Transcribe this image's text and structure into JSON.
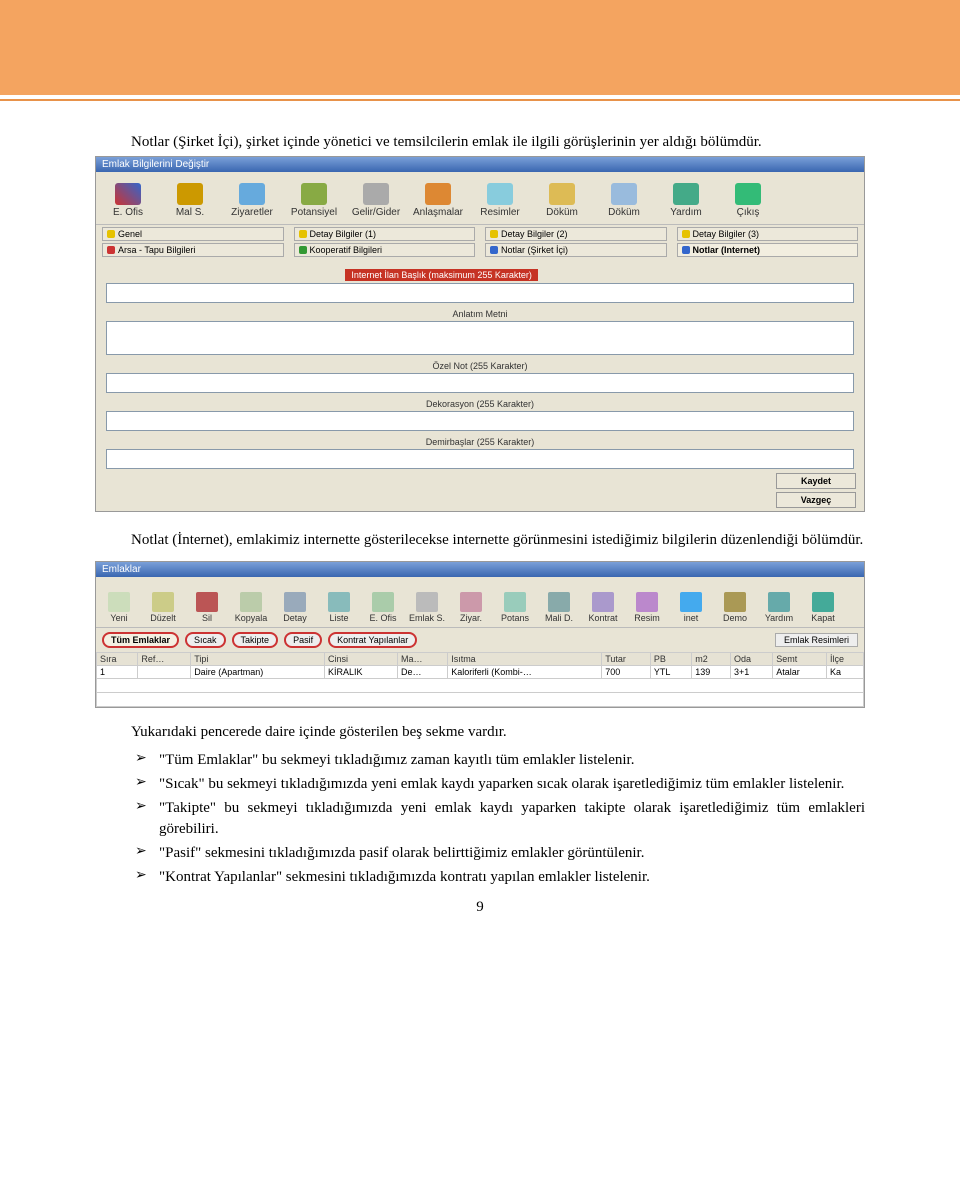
{
  "paragraphs": {
    "p1": "Notlar (Şirket İçi), şirket içinde yönetici ve temsilcilerin emlak ile ilgili görüşlerinin yer aldığı bölümdür.",
    "p2": "Notlat (İnternet), emlakimiz internette gösterilecekse internette görünmesini istediğimiz bilgilerin düzenlendiği bölümdür.",
    "p3": "Yukarıdaki pencerede daire içinde gösterilen beş sekme vardır."
  },
  "bullets": [
    "\"Tüm Emlaklar\" bu sekmeyi tıkladığımız zaman kayıtlı tüm emlakler listelenir.",
    "\"Sıcak\" bu sekmeyi tıkladığımızda yeni emlak kaydı yaparken sıcak olarak işaretlediğimiz tüm emlakler listelenir.",
    "\"Takipte\" bu sekmeyi tıkladığımızda yeni emlak kaydı yaparken takipte olarak işaretlediğimiz tüm emlakleri görebiliri.",
    "\"Pasif\" sekmesini tıkladığımızda pasif olarak belirttiğimiz emlakler görüntülenir.",
    "\"Kontrat Yapılanlar\" sekmesini tıkladığımızda kontratı yapılan emlakler listelenir."
  ],
  "app1": {
    "title": "Emlak Bilgilerini Değiştir",
    "toolbar": [
      "E. Ofis",
      "Mal S.",
      "Ziyaretler",
      "Potansiyel",
      "Gelir/Gider",
      "Anlaşmalar",
      "Resimler",
      "Döküm",
      "Döküm",
      "Yardım",
      "Çıkış"
    ],
    "tabs1": [
      "Genel",
      "Detay Bilgiler (1)",
      "Detay Bilgiler (2)",
      "Detay Bilgiler (3)"
    ],
    "tabs2": [
      "Arsa - Tapu Bilgileri",
      "Kooperatif Bilgileri",
      "Notlar (Şirket İçi)",
      "Notlar (Internet)"
    ],
    "fields": {
      "f1": "Internet İlan Başlık (maksimum 255 Karakter)",
      "f2": "Anlatım Metni",
      "f3": "Özel Not (255 Karakter)",
      "f4": "Dekorasyon (255 Karakter)",
      "f5": "Demirbaşlar (255 Karakter)"
    },
    "buttons": {
      "save": "Kaydet",
      "cancel": "Vazgeç"
    }
  },
  "app2": {
    "title": "Emlaklar",
    "toolbar": [
      "Yeni",
      "Düzelt",
      "Sil",
      "Kopyala",
      "Detay",
      "Liste",
      "E. Ofis",
      "Emlak S.",
      "Ziyar.",
      "Potans",
      "Mali D.",
      "Kontrat",
      "Resim",
      "inet",
      "Demo",
      "Yardım",
      "Kapat"
    ],
    "filterTabs": [
      "Tüm Emlaklar",
      "Sıcak",
      "Takipte",
      "Pasif",
      "Kontrat Yapılanlar"
    ],
    "sideLabel": "Emlak Resimleri",
    "grid": {
      "headers": [
        "Sıra",
        "Ref…",
        "Tipi",
        "Cinsi",
        "Ma…",
        "Isıtma",
        "Tutar",
        "PB",
        "m2",
        "Oda",
        "Semt",
        "İlçe"
      ],
      "row": [
        "1",
        "",
        "Daire (Apartman)",
        "KİRALIK",
        "De…",
        "Kaloriferli (Kombi-…",
        "700",
        "YTL",
        "139",
        "3+1",
        "Atalar",
        "Ka"
      ]
    }
  },
  "page_number": "9"
}
